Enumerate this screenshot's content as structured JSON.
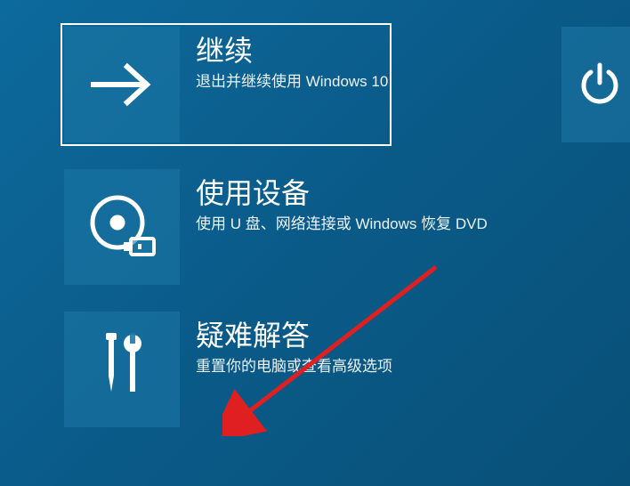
{
  "options": [
    {
      "title": "继续",
      "description": "退出并继续使用 Windows 10"
    },
    {
      "title": "使用设备",
      "description": "使用 U 盘、网络连接或 Windows 恢复 DVD"
    },
    {
      "title": "疑难解答",
      "description": "重置你的电脑或查看高级选项"
    }
  ],
  "selected_index": 0
}
